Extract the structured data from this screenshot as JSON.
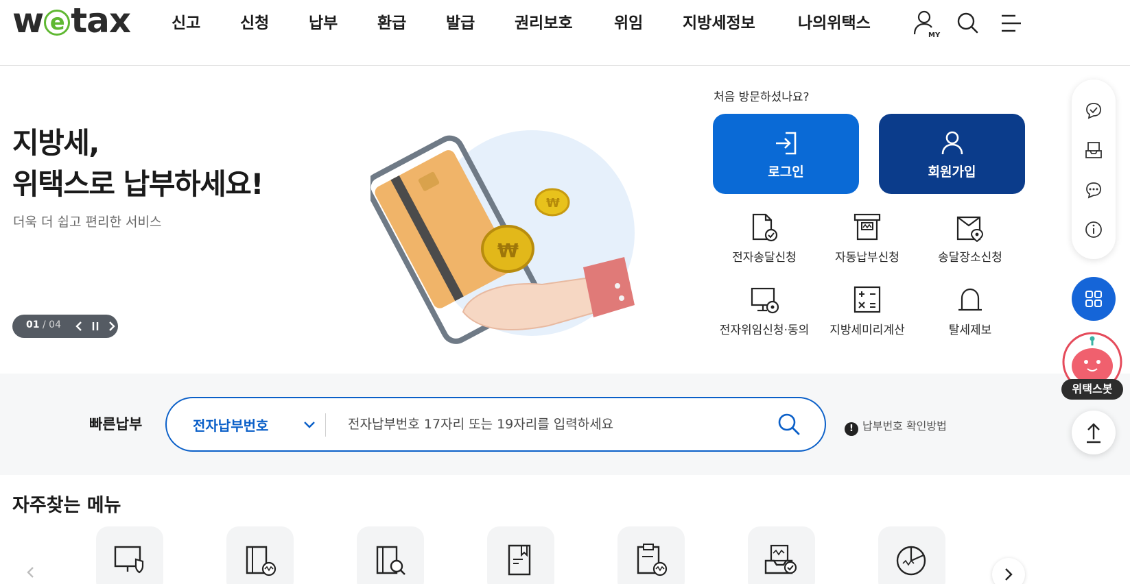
{
  "header": {
    "logo": {
      "w": "w",
      "e": "e",
      "tax": "tax"
    },
    "nav": [
      "신고",
      "신청",
      "납부",
      "환급",
      "발급",
      "권리보호",
      "위임",
      "지방세정보",
      "나의위택스"
    ],
    "my_label": "MY"
  },
  "hero": {
    "title_line1": "지방세,",
    "title_line2": "위택스로 납부하세요!",
    "subtitle": "더욱 더 쉽고 편리한 서비스",
    "slider": {
      "current": "01",
      "total": "/ 04"
    }
  },
  "account": {
    "first_visit": "처음 방문하셨나요?",
    "login_label": "로그인",
    "join_label": "회원가입"
  },
  "quick_menu": [
    {
      "label": "전자송달신청",
      "icon": "e-delivery-icon"
    },
    {
      "label": "자동납부신청",
      "icon": "auto-pay-icon"
    },
    {
      "label": "송달장소신청",
      "icon": "delivery-place-icon"
    },
    {
      "label": "전자위임신청·동의",
      "icon": "e-delegation-icon"
    },
    {
      "label": "지방세미리계산",
      "icon": "calculator-icon"
    },
    {
      "label": "탈세제보",
      "icon": "alarm-bell-icon"
    }
  ],
  "fast_pay": {
    "label": "빠른납부",
    "select_value": "전자납부번호",
    "placeholder": "전자납부번호 17자리 또는 19자리를 입력하세요",
    "help": "납부번호 확인방법",
    "help_icon": "!"
  },
  "frequent": {
    "title": "자주찾는 메뉴"
  },
  "side": {
    "bot_label": "위택스봇"
  },
  "colors": {
    "primary_blue": "#0a6ad6",
    "navy": "#0b3c8b",
    "logo_green": "#5fb832",
    "fast_pay_border": "#0a5fc8"
  }
}
